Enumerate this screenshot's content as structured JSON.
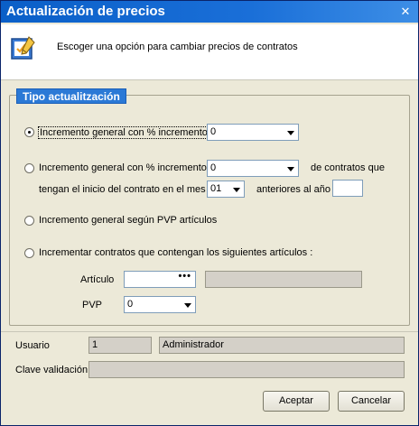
{
  "window": {
    "title": "Actualización de precios",
    "close_label": "✕"
  },
  "header": {
    "description": "Escoger una opción para cambiar precios de contratos"
  },
  "group": {
    "legend": "Tipo actualitzación",
    "option1": {
      "label": "Incremento general con % incremento",
      "value": "0",
      "checked": true
    },
    "option2": {
      "label": "Incremento general con % incremento",
      "value": "0",
      "suffix": "de contratos que",
      "line2": "tengan el inicio del contrato en el mes",
      "month": "01",
      "year_label": "anteriores al año",
      "year_value": ""
    },
    "option3": {
      "label": "Incremento general según PVP artículos"
    },
    "option4": {
      "label": "Incrementar contratos que contengan los siguientes artículos :",
      "articulo_label": "Artículo",
      "articulo_value": "",
      "articulo_button": "•••",
      "articulo_desc": "",
      "pvp_label": "PVP",
      "pvp_value": "0"
    }
  },
  "footer": {
    "usuario_label": "Usuario",
    "usuario_id": "1",
    "usuario_name": "Administrador",
    "clave_label": "Clave validación",
    "clave_value": ""
  },
  "buttons": {
    "accept": "Aceptar",
    "cancel": "Cancelar"
  },
  "colors": {
    "titlebar": "#0a5fc8",
    "legend": "#2b79d6",
    "window_bg": "#ece9d8"
  }
}
